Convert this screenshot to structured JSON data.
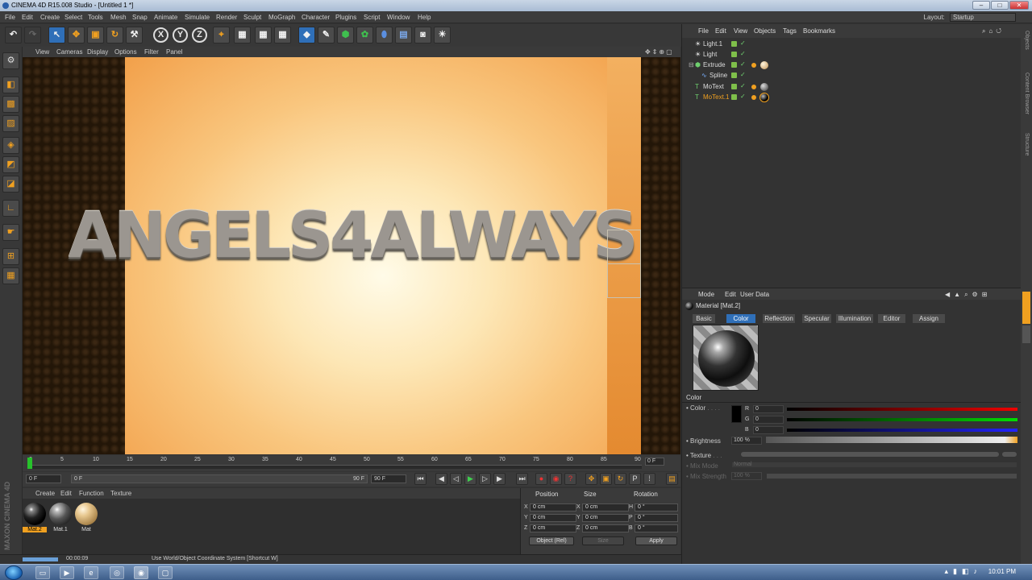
{
  "window": {
    "title": "CINEMA 4D R15.008 Studio - [Untitled 1 *]",
    "controls": [
      "–",
      "□",
      "✕"
    ]
  },
  "menubar": {
    "items": [
      "File",
      "Edit",
      "Create",
      "Select",
      "Tools",
      "Mesh",
      "Snap",
      "Animate",
      "Simulate",
      "Render",
      "Sculpt",
      "MoGraph",
      "Character",
      "Plugins",
      "Script",
      "Window",
      "Help"
    ],
    "layout_label": "Layout:",
    "layout_value": "Startup"
  },
  "viewport": {
    "menu": [
      "View",
      "Cameras",
      "Display",
      "Options",
      "Filter",
      "Panel"
    ],
    "text_3d": "ANGELS4ALWAYS"
  },
  "timeline": {
    "ticks": [
      "0",
      "5",
      "10",
      "15",
      "20",
      "25",
      "30",
      "35",
      "40",
      "45",
      "50",
      "55",
      "60",
      "65",
      "70",
      "75",
      "80",
      "85",
      "90"
    ],
    "current_frame_suffix": "0 F"
  },
  "playback": {
    "start_frame": "0 F",
    "min_frame": "0 F",
    "max_frame": "90 F",
    "end_frame": "90 F"
  },
  "material_manager": {
    "menu": [
      "Create",
      "Edit",
      "Function",
      "Texture"
    ],
    "materials": [
      {
        "name": "Mat.2",
        "active": true
      },
      {
        "name": "Mat.1",
        "active": false
      },
      {
        "name": "Mat",
        "active": false
      }
    ]
  },
  "coordinates": {
    "headers": [
      "Position",
      "Size",
      "Rotation"
    ],
    "rows": [
      {
        "pl": "X",
        "pv": "0 cm",
        "sl": "X",
        "sv": "0 cm",
        "rl": "H",
        "rv": "0 °"
      },
      {
        "pl": "Y",
        "pv": "0 cm",
        "sl": "Y",
        "sv": "0 cm",
        "rl": "P",
        "rv": "0 °"
      },
      {
        "pl": "Z",
        "pv": "0 cm",
        "sl": "Z",
        "sv": "0 cm",
        "rl": "B",
        "rv": "0 °"
      }
    ],
    "mode": "Object (Rel)",
    "size_mode": "Size",
    "apply": "Apply"
  },
  "status": {
    "time": "00:00:09",
    "message": "Use World/Object Coordinate System [Shortcut W]"
  },
  "logo": "MAXON CINEMA 4D",
  "object_manager": {
    "menu": [
      "File",
      "Edit",
      "View",
      "Objects",
      "Tags",
      "Bookmarks"
    ],
    "objects": [
      {
        "name": "Light.1",
        "indent": 1,
        "selected": false
      },
      {
        "name": "Light",
        "indent": 1,
        "selected": false
      },
      {
        "name": "Extrude",
        "indent": 1,
        "selected": false
      },
      {
        "name": "Spline",
        "indent": 2,
        "selected": false
      },
      {
        "name": "MoText",
        "indent": 1,
        "selected": false
      },
      {
        "name": "MoText.1",
        "indent": 1,
        "selected": true
      }
    ]
  },
  "side_tabs": [
    "Objects",
    "Content Browser",
    "Structure"
  ],
  "attribute_manager": {
    "menu": [
      "Mode",
      "Edit",
      "User Data"
    ],
    "header": "Material [Mat.2]",
    "tabs": [
      {
        "label": "Basic",
        "active": false
      },
      {
        "label": "Color",
        "active": true
      },
      {
        "label": "Reflection",
        "active": false
      },
      {
        "label": "Specular",
        "active": false
      },
      {
        "label": "Illumination",
        "active": false
      },
      {
        "label": "Editor",
        "active": false
      },
      {
        "label": "Assign",
        "active": false
      }
    ],
    "section": "Color",
    "color_label": "Color",
    "r": "0",
    "g": "0",
    "b": "0",
    "brightness_label": "Brightness",
    "brightness_value": "100 %",
    "texture_label": "Texture",
    "mix_mode_label": "Mix Mode",
    "mix_mode_value": "Normal",
    "mix_strength_label": "Mix Strength",
    "mix_strength_value": "100 %"
  },
  "taskbar": {
    "clock": "10:01 PM"
  },
  "colors": {
    "accent": "#f0a020",
    "select_blue": "#2f6fb8",
    "green": "#27c22b"
  }
}
